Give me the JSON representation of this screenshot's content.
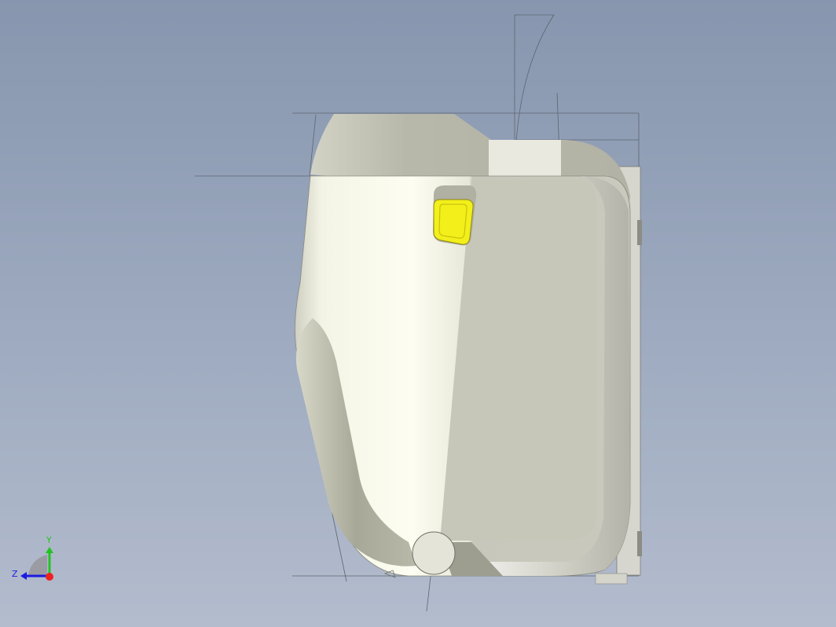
{
  "viewport": {
    "background_top": "#8796ae",
    "background_bottom": "#b3bccd"
  },
  "model": {
    "body_color": "#e8e8dc",
    "body_shadow": "#bdbdb0",
    "highlight_color": "#fdfdf0",
    "button_color": "#f2ef1a"
  },
  "triad": {
    "y_label": "Y",
    "z_label": "Z",
    "y_color": "#22c322",
    "z_color": "#1a1ae0",
    "x_color": "#ee2020"
  }
}
